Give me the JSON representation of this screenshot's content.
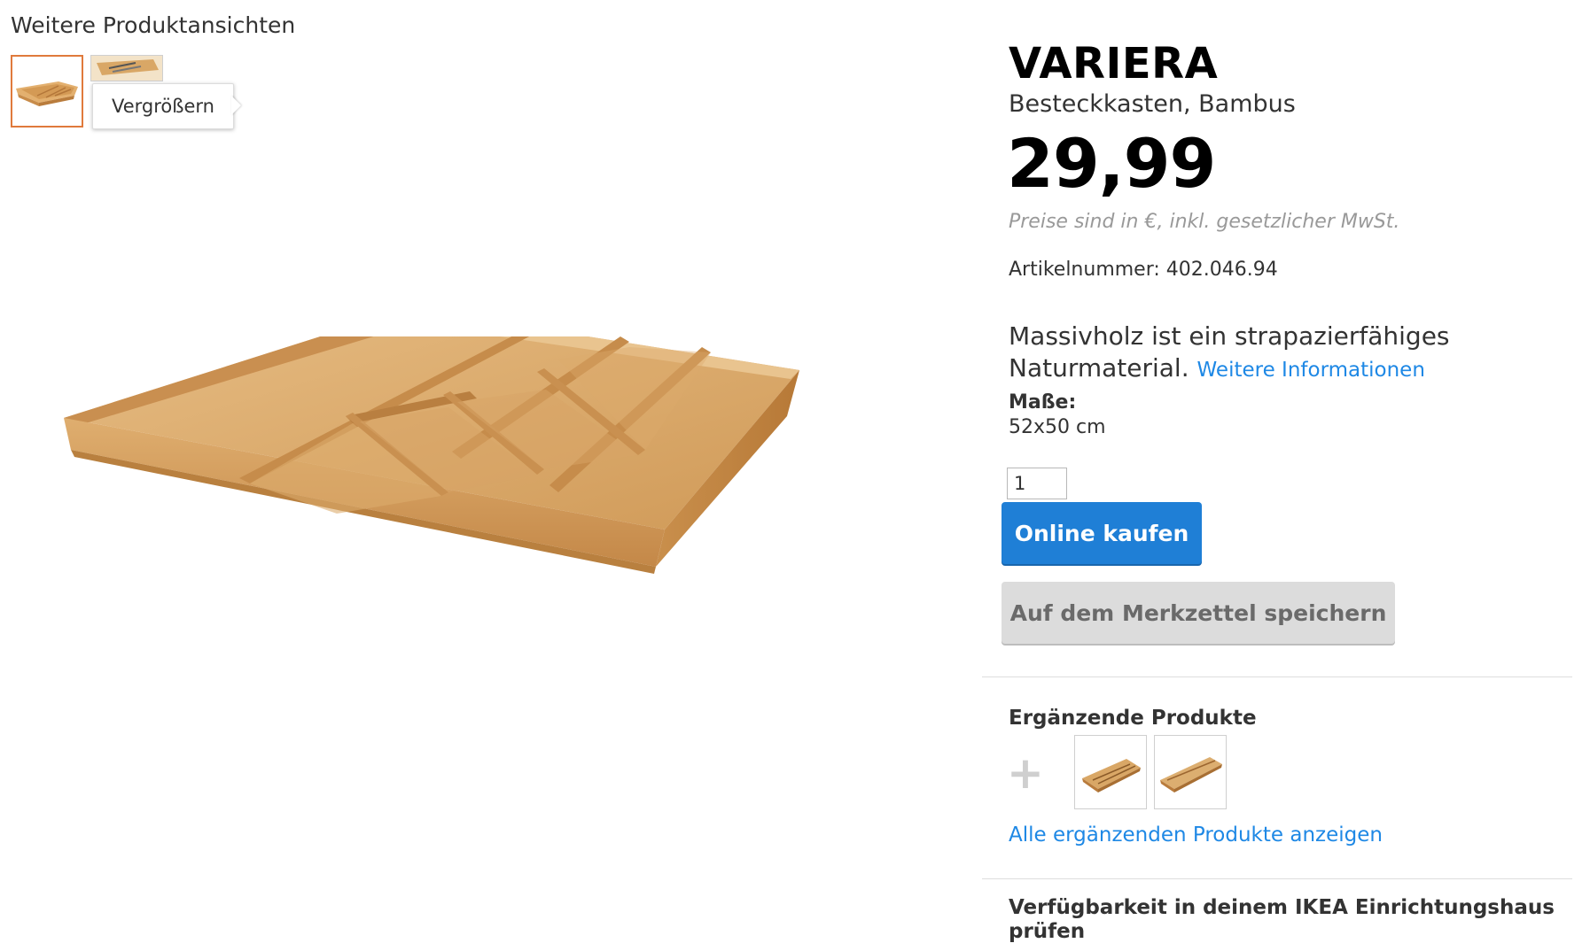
{
  "views": {
    "title": "Weitere Produktansichten",
    "tooltip": "Vergrößern"
  },
  "product": {
    "name": "VARIERA",
    "subtitle": "Besteckkasten, Bambus",
    "price": "29,99",
    "price_note": "Preise sind in €, inkl. gesetzlicher MwSt.",
    "article_label": "Artikelnummer:",
    "article_number": "402.046.94",
    "description": "Massivholz ist ein strapazierfähiges Naturmaterial.",
    "more_info_link": "Weitere Informationen",
    "dimensions_label": "Maße:",
    "dimensions_value": "52x50 cm"
  },
  "purchase": {
    "quantity": "1",
    "buy_label": "Online kaufen",
    "save_label": "Auf dem Merkzettel speichern"
  },
  "related": {
    "title": "Ergänzende Produkte",
    "add_icon": "plus-icon",
    "show_all_link": "Alle ergänzenden Produkte anzeigen"
  },
  "availability": {
    "title": "Verfügbarkeit in deinem IKEA Einrichtungshaus prüfen"
  },
  "colors": {
    "accent_blue": "#1f7fd6",
    "link_blue": "#1e88e5",
    "thumb_selected": "#e07a3c",
    "wood": "#d9a766"
  }
}
